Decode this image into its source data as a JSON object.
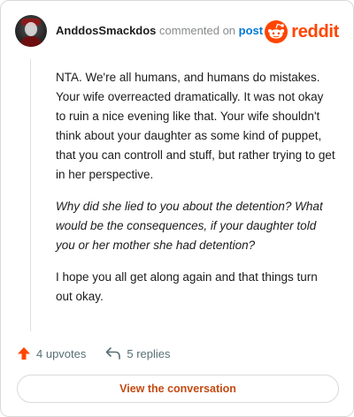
{
  "header": {
    "username": "AnddosSmackdos",
    "meta_text": " commented on ",
    "post_link": "post",
    "logo_text": "reddit"
  },
  "comment": {
    "paragraphs": [
      "NTA. We're all humans, and humans do mistakes. Your wife overreacted dramatically. It was not okay to ruin a nice evening like that. Your wife shouldn't think about your daughter as some kind of puppet, that you can controll and stuff, but rather trying to get in her perspective.",
      "Why did she lied to you about the detention? What would be the consequences, if your daughter told you or her mother she had detention?",
      "I hope you all get along again and that things turn out okay."
    ]
  },
  "actions": {
    "upvotes": "4 upvotes",
    "replies": "5 replies"
  },
  "footer": {
    "view_button": "View the conversation"
  },
  "colors": {
    "brand": "#ff4500",
    "link": "#0079d3",
    "button_text": "#c44a12"
  },
  "icons": {
    "logo": "reddit-snoo-icon",
    "upvote": "upvote-arrow-icon",
    "reply": "reply-arrow-icon"
  }
}
